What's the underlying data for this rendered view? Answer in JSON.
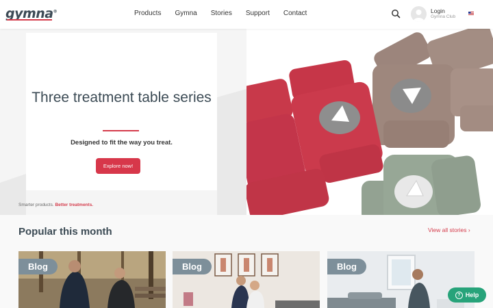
{
  "header": {
    "logo": "gymna",
    "logo_mark": "®",
    "nav": [
      "Products",
      "Gymna",
      "Stories",
      "Support",
      "Contact"
    ],
    "login_label": "Login",
    "login_sub": "Gymna Club",
    "icons": {
      "search": "search-icon",
      "avatar": "user-avatar-icon",
      "flag": "us-flag-icon"
    }
  },
  "hero": {
    "title": "Three treatment table series",
    "subtitle": "Designed to fit the way you treat.",
    "button": "Explore now!",
    "tagline_prefix": "Smarter products.",
    "tagline_emphasis": "Better treatments."
  },
  "popular": {
    "title": "Popular this month",
    "view_all": "View all stories",
    "cards": [
      {
        "tag": "Blog"
      },
      {
        "tag": "Blog"
      },
      {
        "tag": "Blog"
      }
    ]
  },
  "help": {
    "label": "Help"
  },
  "colors": {
    "brand_red": "#d7374a",
    "text_dark": "#3b4a54",
    "help_green": "#27a37a",
    "tag_gray": "#7d8f9a"
  }
}
